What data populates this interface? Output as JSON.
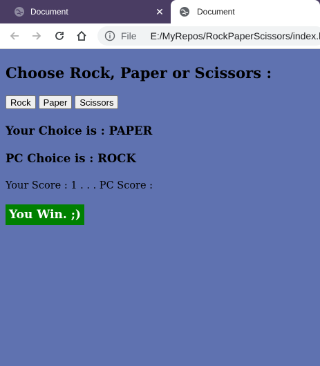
{
  "browser": {
    "tabs": [
      {
        "title": "Document",
        "active": false
      },
      {
        "title": "Document",
        "active": true
      }
    ],
    "close_glyph": "✕",
    "address": {
      "info_label": "File",
      "url": "E:/MyRepos/RockPaperScissors/index.html"
    },
    "nav_icons": [
      "back-arrow-icon",
      "forward-arrow-icon",
      "reload-icon",
      "home-icon"
    ]
  },
  "page": {
    "heading": "Choose Rock, Paper or Scissors :",
    "buttons": {
      "rock": "Rock",
      "paper": "Paper",
      "scissors": "Scissors"
    },
    "your_choice": "Your Choice is : PAPER",
    "pc_choice": "PC Choice is : ROCK",
    "score": "Your Score : 1 . . . PC Score :",
    "result": "You Win. ;)"
  },
  "colors": {
    "page_background": "#5f72b0",
    "result_background": "#008000",
    "tabstrip": "#4a3d63"
  }
}
